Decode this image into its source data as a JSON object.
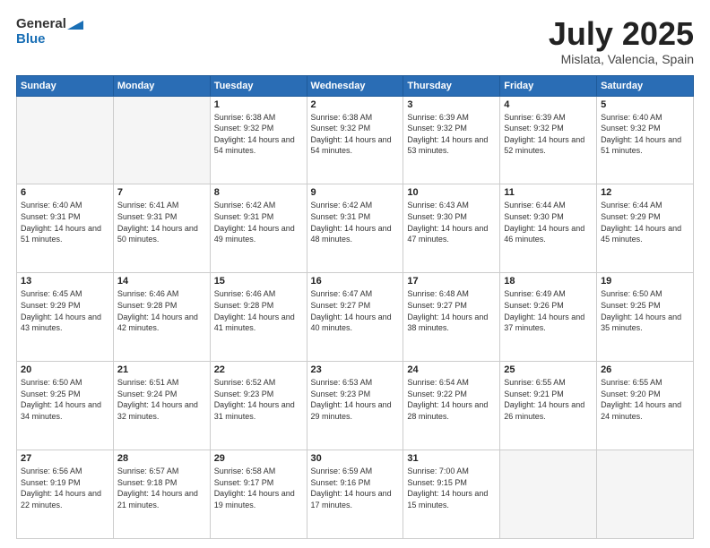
{
  "header": {
    "logo_line1": "General",
    "logo_line2": "Blue",
    "month_year": "July 2025",
    "location": "Mislata, Valencia, Spain"
  },
  "weekdays": [
    "Sunday",
    "Monday",
    "Tuesday",
    "Wednesday",
    "Thursday",
    "Friday",
    "Saturday"
  ],
  "weeks": [
    [
      {
        "day": "",
        "sunrise": "",
        "sunset": "",
        "daylight": "",
        "empty": true
      },
      {
        "day": "",
        "sunrise": "",
        "sunset": "",
        "daylight": "",
        "empty": true
      },
      {
        "day": "1",
        "sunrise": "Sunrise: 6:38 AM",
        "sunset": "Sunset: 9:32 PM",
        "daylight": "Daylight: 14 hours and 54 minutes.",
        "empty": false
      },
      {
        "day": "2",
        "sunrise": "Sunrise: 6:38 AM",
        "sunset": "Sunset: 9:32 PM",
        "daylight": "Daylight: 14 hours and 54 minutes.",
        "empty": false
      },
      {
        "day": "3",
        "sunrise": "Sunrise: 6:39 AM",
        "sunset": "Sunset: 9:32 PM",
        "daylight": "Daylight: 14 hours and 53 minutes.",
        "empty": false
      },
      {
        "day": "4",
        "sunrise": "Sunrise: 6:39 AM",
        "sunset": "Sunset: 9:32 PM",
        "daylight": "Daylight: 14 hours and 52 minutes.",
        "empty": false
      },
      {
        "day": "5",
        "sunrise": "Sunrise: 6:40 AM",
        "sunset": "Sunset: 9:32 PM",
        "daylight": "Daylight: 14 hours and 51 minutes.",
        "empty": false
      }
    ],
    [
      {
        "day": "6",
        "sunrise": "Sunrise: 6:40 AM",
        "sunset": "Sunset: 9:31 PM",
        "daylight": "Daylight: 14 hours and 51 minutes.",
        "empty": false
      },
      {
        "day": "7",
        "sunrise": "Sunrise: 6:41 AM",
        "sunset": "Sunset: 9:31 PM",
        "daylight": "Daylight: 14 hours and 50 minutes.",
        "empty": false
      },
      {
        "day": "8",
        "sunrise": "Sunrise: 6:42 AM",
        "sunset": "Sunset: 9:31 PM",
        "daylight": "Daylight: 14 hours and 49 minutes.",
        "empty": false
      },
      {
        "day": "9",
        "sunrise": "Sunrise: 6:42 AM",
        "sunset": "Sunset: 9:31 PM",
        "daylight": "Daylight: 14 hours and 48 minutes.",
        "empty": false
      },
      {
        "day": "10",
        "sunrise": "Sunrise: 6:43 AM",
        "sunset": "Sunset: 9:30 PM",
        "daylight": "Daylight: 14 hours and 47 minutes.",
        "empty": false
      },
      {
        "day": "11",
        "sunrise": "Sunrise: 6:44 AM",
        "sunset": "Sunset: 9:30 PM",
        "daylight": "Daylight: 14 hours and 46 minutes.",
        "empty": false
      },
      {
        "day": "12",
        "sunrise": "Sunrise: 6:44 AM",
        "sunset": "Sunset: 9:29 PM",
        "daylight": "Daylight: 14 hours and 45 minutes.",
        "empty": false
      }
    ],
    [
      {
        "day": "13",
        "sunrise": "Sunrise: 6:45 AM",
        "sunset": "Sunset: 9:29 PM",
        "daylight": "Daylight: 14 hours and 43 minutes.",
        "empty": false
      },
      {
        "day": "14",
        "sunrise": "Sunrise: 6:46 AM",
        "sunset": "Sunset: 9:28 PM",
        "daylight": "Daylight: 14 hours and 42 minutes.",
        "empty": false
      },
      {
        "day": "15",
        "sunrise": "Sunrise: 6:46 AM",
        "sunset": "Sunset: 9:28 PM",
        "daylight": "Daylight: 14 hours and 41 minutes.",
        "empty": false
      },
      {
        "day": "16",
        "sunrise": "Sunrise: 6:47 AM",
        "sunset": "Sunset: 9:27 PM",
        "daylight": "Daylight: 14 hours and 40 minutes.",
        "empty": false
      },
      {
        "day": "17",
        "sunrise": "Sunrise: 6:48 AM",
        "sunset": "Sunset: 9:27 PM",
        "daylight": "Daylight: 14 hours and 38 minutes.",
        "empty": false
      },
      {
        "day": "18",
        "sunrise": "Sunrise: 6:49 AM",
        "sunset": "Sunset: 9:26 PM",
        "daylight": "Daylight: 14 hours and 37 minutes.",
        "empty": false
      },
      {
        "day": "19",
        "sunrise": "Sunrise: 6:50 AM",
        "sunset": "Sunset: 9:25 PM",
        "daylight": "Daylight: 14 hours and 35 minutes.",
        "empty": false
      }
    ],
    [
      {
        "day": "20",
        "sunrise": "Sunrise: 6:50 AM",
        "sunset": "Sunset: 9:25 PM",
        "daylight": "Daylight: 14 hours and 34 minutes.",
        "empty": false
      },
      {
        "day": "21",
        "sunrise": "Sunrise: 6:51 AM",
        "sunset": "Sunset: 9:24 PM",
        "daylight": "Daylight: 14 hours and 32 minutes.",
        "empty": false
      },
      {
        "day": "22",
        "sunrise": "Sunrise: 6:52 AM",
        "sunset": "Sunset: 9:23 PM",
        "daylight": "Daylight: 14 hours and 31 minutes.",
        "empty": false
      },
      {
        "day": "23",
        "sunrise": "Sunrise: 6:53 AM",
        "sunset": "Sunset: 9:23 PM",
        "daylight": "Daylight: 14 hours and 29 minutes.",
        "empty": false
      },
      {
        "day": "24",
        "sunrise": "Sunrise: 6:54 AM",
        "sunset": "Sunset: 9:22 PM",
        "daylight": "Daylight: 14 hours and 28 minutes.",
        "empty": false
      },
      {
        "day": "25",
        "sunrise": "Sunrise: 6:55 AM",
        "sunset": "Sunset: 9:21 PM",
        "daylight": "Daylight: 14 hours and 26 minutes.",
        "empty": false
      },
      {
        "day": "26",
        "sunrise": "Sunrise: 6:55 AM",
        "sunset": "Sunset: 9:20 PM",
        "daylight": "Daylight: 14 hours and 24 minutes.",
        "empty": false
      }
    ],
    [
      {
        "day": "27",
        "sunrise": "Sunrise: 6:56 AM",
        "sunset": "Sunset: 9:19 PM",
        "daylight": "Daylight: 14 hours and 22 minutes.",
        "empty": false
      },
      {
        "day": "28",
        "sunrise": "Sunrise: 6:57 AM",
        "sunset": "Sunset: 9:18 PM",
        "daylight": "Daylight: 14 hours and 21 minutes.",
        "empty": false
      },
      {
        "day": "29",
        "sunrise": "Sunrise: 6:58 AM",
        "sunset": "Sunset: 9:17 PM",
        "daylight": "Daylight: 14 hours and 19 minutes.",
        "empty": false
      },
      {
        "day": "30",
        "sunrise": "Sunrise: 6:59 AM",
        "sunset": "Sunset: 9:16 PM",
        "daylight": "Daylight: 14 hours and 17 minutes.",
        "empty": false
      },
      {
        "day": "31",
        "sunrise": "Sunrise: 7:00 AM",
        "sunset": "Sunset: 9:15 PM",
        "daylight": "Daylight: 14 hours and 15 minutes.",
        "empty": false
      },
      {
        "day": "",
        "sunrise": "",
        "sunset": "",
        "daylight": "",
        "empty": true
      },
      {
        "day": "",
        "sunrise": "",
        "sunset": "",
        "daylight": "",
        "empty": true
      }
    ]
  ]
}
